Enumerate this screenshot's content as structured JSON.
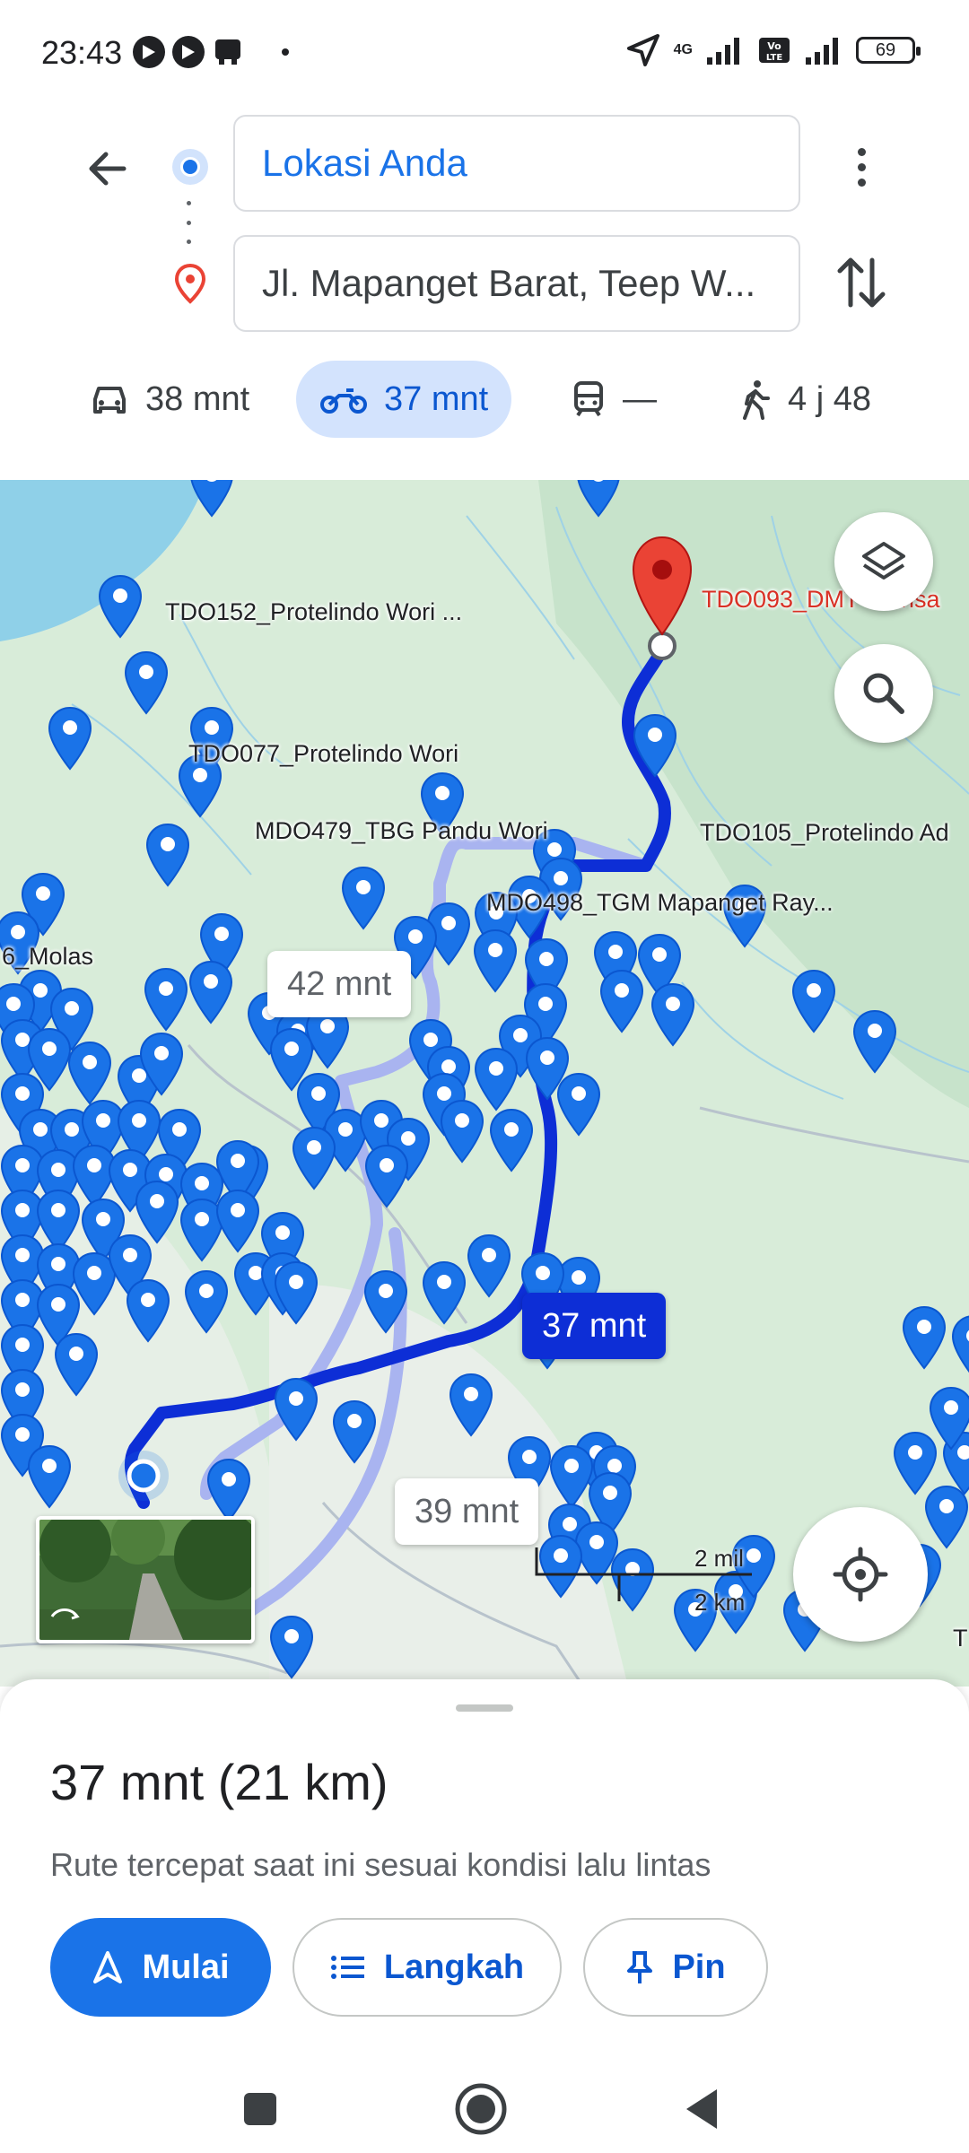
{
  "status_bar": {
    "time": "23:43",
    "network_label": "4G",
    "volte_label": "Vo LTE",
    "battery": "69"
  },
  "directions": {
    "origin": "Lokasi Anda",
    "destination": "Jl. Mapanget Barat, Teep W...",
    "icons": {
      "back": "arrow-left-icon",
      "origin": "current-location-dot-icon",
      "destination": "red-pin-icon",
      "more": "more-vert-icon",
      "swap": "swap-vert-icon"
    }
  },
  "modes": [
    {
      "name": "car",
      "icon": "car-icon",
      "label": "38 mnt",
      "active": false
    },
    {
      "name": "motorcycle",
      "icon": "motorcycle-icon",
      "label": "37 mnt",
      "active": true
    },
    {
      "name": "transit",
      "icon": "train-icon",
      "label": "—",
      "active": false
    },
    {
      "name": "walk",
      "icon": "walk-icon",
      "label": "4 j 48",
      "active": false
    }
  ],
  "map": {
    "labels": {
      "tdo152": "TDO152_Protelindo Wori ...",
      "tdo077": "TDO077_Protelindo Wori",
      "mdo479": "MDO479_TBG Pandu Wori",
      "tdo105": "TDO105_Protelindo Ad",
      "mdo498": "MDO498_TGM Mapanget Ray...",
      "molas": "6_Molas",
      "tdo093": "TDO093_DMT Warisa",
      "edge_t": "T"
    },
    "route_times": {
      "alt1": "42 mnt",
      "primary": "37 mnt",
      "alt2": "39 mnt"
    },
    "scale": {
      "miles": "2 mil",
      "km": "2 km"
    },
    "colors": {
      "route": "#0d2ed6",
      "alt_route": "#a9b4f0",
      "pin": "#1a73e8",
      "destination_pin": "#ea4335",
      "land": "#d8ecd9",
      "water": "#8fd0e8"
    },
    "icons": {
      "layers": "layers-icon",
      "search": "search-icon",
      "my_location": "my-location-icon",
      "street_view": "street-view-thumbnail"
    }
  },
  "sheet": {
    "summary": "37 mnt (21 km)",
    "subtext": "Rute tercepat saat ini sesuai kondisi lalu lintas",
    "buttons": {
      "start": "Mulai",
      "steps": "Langkah",
      "pin": "Pin"
    }
  },
  "navbar": {
    "icons": [
      "recents-square-icon",
      "home-circle-icon",
      "back-triangle-icon"
    ]
  }
}
